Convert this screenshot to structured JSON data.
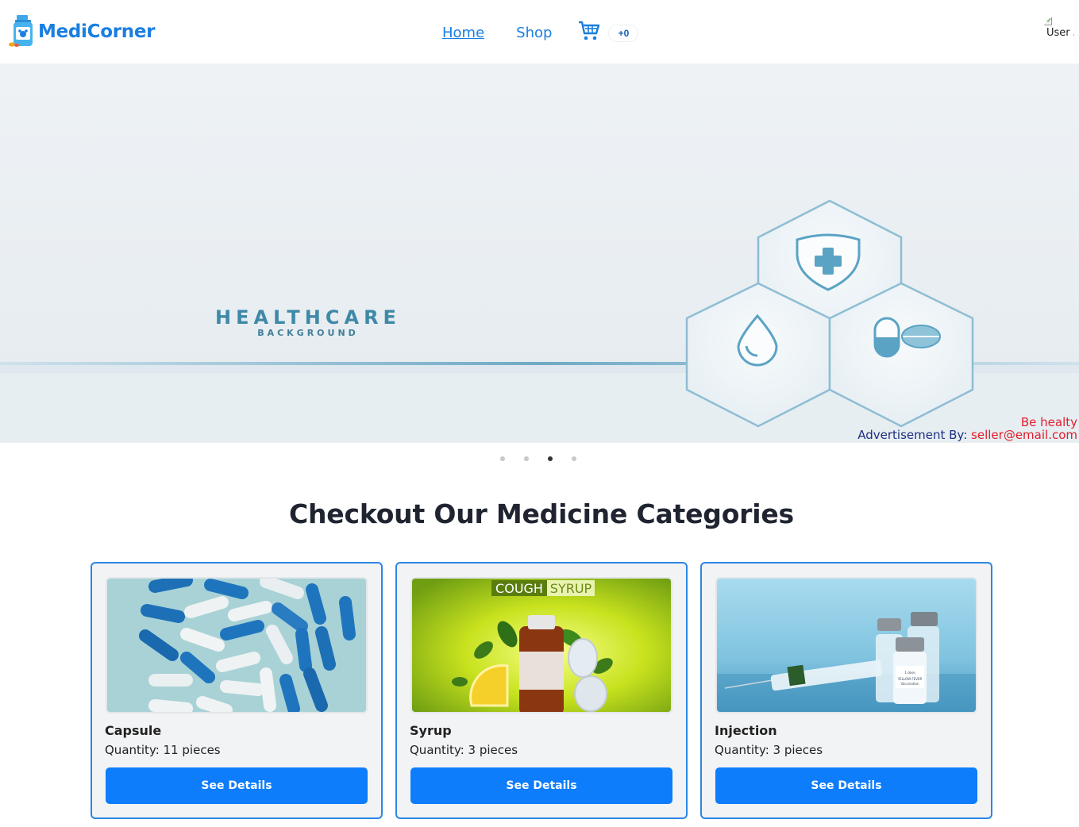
{
  "brand": {
    "name": "MediCorner"
  },
  "nav": {
    "links": [
      {
        "label": "Home",
        "active": true
      },
      {
        "label": "Shop",
        "active": false
      }
    ],
    "cart_count": "+0",
    "avatar_alt": "User Avatar"
  },
  "banner": {
    "headline": "HEALTHCARE",
    "subheadline": "BACKGROUND",
    "caption_line1": "Be healty",
    "caption_prefix": "Advertisement By:",
    "caption_email": "seller@email.com",
    "slide_count": 4,
    "active_slide": 3
  },
  "categories_section": {
    "title": "Checkout Our Medicine Categories",
    "cards": [
      {
        "name": "Capsule",
        "quantity": "Quantity: 11 pieces",
        "button": "See Details",
        "image": "capsule-image"
      },
      {
        "name": "Syrup",
        "quantity": "Quantity: 3 pieces",
        "button": "See Details",
        "image": "syrup-image"
      },
      {
        "name": "Injection",
        "quantity": "Quantity: 3 pieces",
        "button": "See Details",
        "image": "injection-image"
      }
    ],
    "syrup_image_text": [
      "COUGH",
      "SYRUP"
    ],
    "injection_vial_label": [
      "1 dose",
      "YELLOW FEVER",
      "Vaccination"
    ]
  },
  "colors": {
    "brand_blue": "#1a7fe0",
    "button_blue": "#0d7dfc",
    "caption_red": "#e11d2a",
    "caption_navy": "#1e2f80"
  }
}
